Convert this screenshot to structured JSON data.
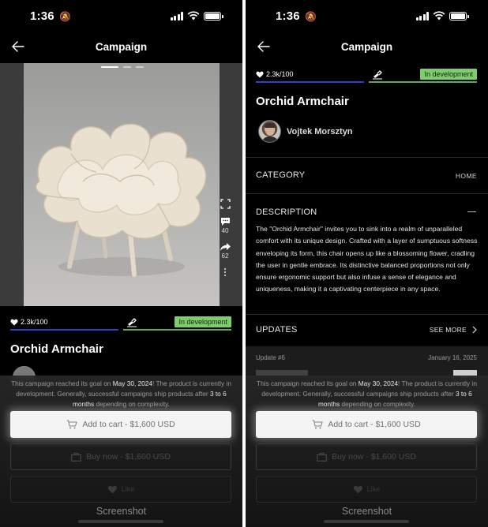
{
  "status": {
    "time": "1:36"
  },
  "nav": {
    "title": "Campaign"
  },
  "hero": {
    "comments": "40",
    "shares": "62"
  },
  "progress": {
    "likes": "2.3k/100",
    "badge": "In development"
  },
  "product": {
    "title": "Orchid Armchair"
  },
  "creator": {
    "name": "Vojtek Morsztyn"
  },
  "category": {
    "label": "CATEGORY",
    "value": "HOME"
  },
  "description": {
    "label": "DESCRIPTION",
    "text": "The \"Orchid Armchair\" invites you to sink into a realm of unparalleled comfort with its unique design. Crafted with a layer of sumptuous softness enveloping its form, this chair opens up like a blossoming flower, cradling the user in gentle embrace. Its distinctive balanced proportions not only ensure ergonomic support but also infuse a sense of elegance and uniqueness, making it a captivating centerpiece in any space."
  },
  "updates": {
    "label": "UPDATES",
    "see_more": "SEE MORE",
    "item_number": "Update #6",
    "item_date": "January 16, 2025"
  },
  "notice": {
    "part1": "This campaign reached its goal on ",
    "date": "May 30, 2024",
    "part2": "! The product is currently in development. Generally, successful campaigns ship products after ",
    "months": "3 to 6 months",
    "part3": " depending on complexity."
  },
  "actions": {
    "add_to_cart": "Add to cart - $1,600 USD",
    "buy_now": "Buy now - $1,600 USD",
    "like": "Like"
  },
  "overlay_label": "Screenshot",
  "colors": {
    "progress_blue": "#2f3fd0",
    "progress_green": "#5fa95a",
    "badge_green": "#7fcc6f"
  }
}
